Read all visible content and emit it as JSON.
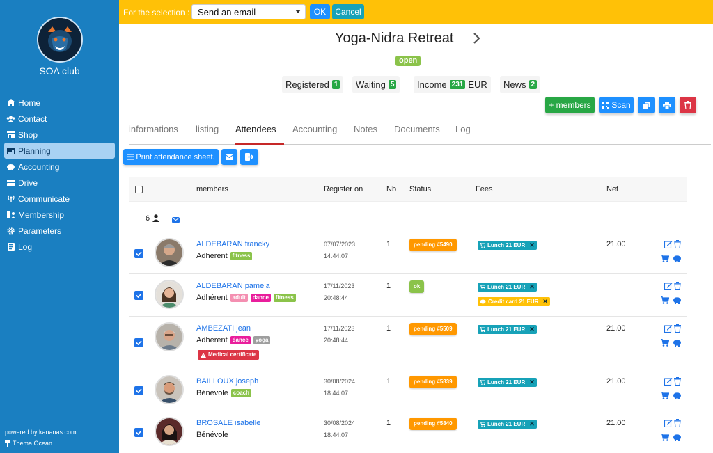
{
  "sidebar": {
    "club_name": "SOA club",
    "nav": [
      {
        "label": "Home",
        "icon": "home-icon"
      },
      {
        "label": "Contact",
        "icon": "users-icon"
      },
      {
        "label": "Shop",
        "icon": "store-icon"
      },
      {
        "label": "Planning",
        "icon": "calendar-icon",
        "active": true
      },
      {
        "label": "Accounting",
        "icon": "piggy-bank-icon"
      },
      {
        "label": "Drive",
        "icon": "drive-icon"
      },
      {
        "label": "Communicate",
        "icon": "broadcast-icon"
      },
      {
        "label": "Membership",
        "icon": "membership-icon"
      },
      {
        "label": "Parameters",
        "icon": "gear-icon"
      },
      {
        "label": "Log",
        "icon": "log-icon"
      }
    ],
    "powered": "powered by kananas.com",
    "theme": "Thema Ocean"
  },
  "selection_bar": {
    "label": "For the selection :",
    "selected_action": "Send an email",
    "ok": "OK",
    "cancel": "Cancel"
  },
  "event": {
    "title": "Yoga-Nidra Retreat",
    "status": "open",
    "stats": {
      "registered_label": "Registered",
      "registered": "1",
      "waiting_label": "Waiting",
      "waiting": "5",
      "income_label": "Income",
      "income": "231",
      "income_unit": "EUR",
      "news_label": "News",
      "news": "2"
    }
  },
  "actions": {
    "members": "+ members",
    "scan": "Scan"
  },
  "tabs": [
    "informations",
    "listing",
    "Attendees",
    "Accounting",
    "Notes",
    "Documents",
    "Log"
  ],
  "toolbar": {
    "print": "Print attendance sheet."
  },
  "table": {
    "headers": {
      "members": "members",
      "register_on": "Register on",
      "nb": "Nb",
      "status": "Status",
      "fees": "Fees",
      "net": "Net"
    },
    "summary_count": "6"
  },
  "colors": {
    "sidebar": "#1a7fc1",
    "selection_bar": "#ffc107",
    "primary": "#1e90ff",
    "pending": "#ff9800",
    "ok": "#8bc34a",
    "fee": "#17a2b8",
    "danger": "#dc3545"
  },
  "attendees": [
    {
      "name": "ALDEBARAN francky",
      "role": "Adhérent",
      "tags": [
        "fitness"
      ],
      "date": "07/07/2023",
      "time": "14:44:07",
      "nb": "1",
      "status": "pending #5490",
      "fees": [
        "Lunch 21 EUR"
      ],
      "net": "21.00"
    },
    {
      "name": "ALDEBARAN pamela",
      "role": "Adhérent",
      "tags": [
        "adult",
        "dance",
        "fitness"
      ],
      "date": "17/11/2023",
      "time": "20:48:44",
      "nb": "1",
      "status": "ok",
      "fees": [
        "Lunch 21 EUR",
        "Credit card 21 EUR"
      ],
      "net": ""
    },
    {
      "name": "AMBEZATI jean",
      "role": "Adhérent",
      "tags": [
        "dance",
        "yoga"
      ],
      "warning": "Medical certificate",
      "date": "17/11/2023",
      "time": "20:48:44",
      "nb": "1",
      "status": "pending #5509",
      "fees": [
        "Lunch 21 EUR"
      ],
      "net": "21.00"
    },
    {
      "name": "BAILLOUX joseph",
      "role": "Bénévole",
      "tags": [
        "coach"
      ],
      "date": "30/08/2024",
      "time": "18:44:07",
      "nb": "1",
      "status": "pending #5839",
      "fees": [
        "Lunch 21 EUR"
      ],
      "net": "21.00"
    },
    {
      "name": "BROSALE isabelle",
      "role": "Bénévole",
      "tags": [],
      "date": "30/08/2024",
      "time": "18:44:07",
      "nb": "1",
      "status": "pending #5840",
      "fees": [
        "Lunch 21 EUR"
      ],
      "net": "21.00"
    }
  ]
}
